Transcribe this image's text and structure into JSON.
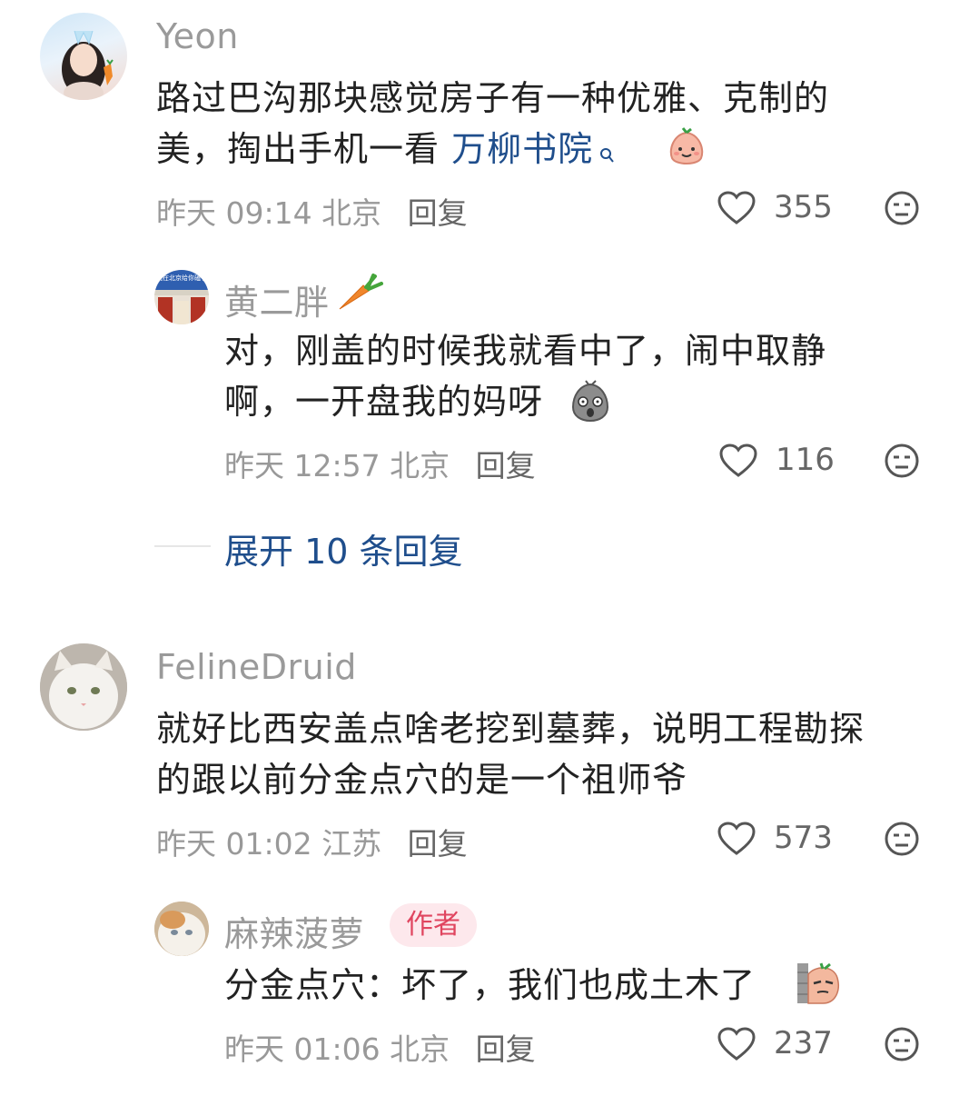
{
  "comments": [
    {
      "user": "Yeon",
      "content_line1": "路过巴沟那块感觉房子有一种优雅、克制的",
      "content_line2_prefix": "美，掏出手机一看 ",
      "link_text": "万柳书院",
      "time": "昨天 09:14",
      "location": "北京",
      "reply_label": "回复",
      "likes": "355",
      "replies": [
        {
          "user": "黄二胖",
          "avatar_text": "我在北京给你磕了",
          "content_line1": "对，刚盖的时候我就看中了，闹中取静",
          "content_line2": "啊，一开盘我的妈呀",
          "time": "昨天 12:57",
          "location": "北京",
          "reply_label": "回复",
          "likes": "116"
        }
      ],
      "expand_label": "展开 10 条回复"
    },
    {
      "user": "FelineDruid",
      "content_line1": "就好比西安盖点啥老挖到墓葬，说明工程勘探",
      "content_line2": "的跟以前分金点穴的是一个祖师爷",
      "time": "昨天 01:02",
      "location": "江苏",
      "reply_label": "回复",
      "likes": "573",
      "replies": [
        {
          "user": "麻辣菠萝",
          "badge": "作者",
          "content_line1": "分金点穴：坏了，我们也成土木了",
          "time": "昨天 01:06",
          "location": "北京",
          "reply_label": "回复",
          "likes": "237"
        }
      ]
    }
  ],
  "colors": {
    "link": "#1f4e8c",
    "badge_bg": "#fde8ec",
    "badge_text": "#e0455f"
  }
}
